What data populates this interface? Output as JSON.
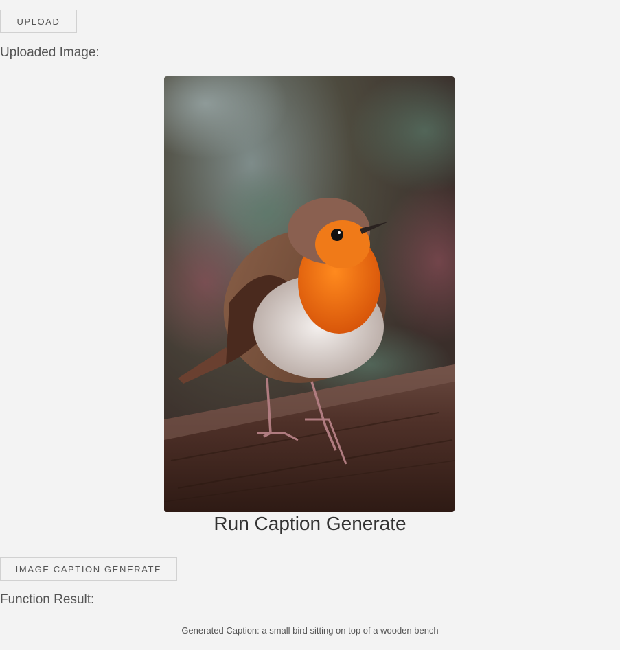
{
  "toolbar": {
    "upload_label": "UPLOAD"
  },
  "uploaded": {
    "label": "Uploaded Image:",
    "image_icon": "robin-photo"
  },
  "run": {
    "title": "Run Caption Generate",
    "button_label": "IMAGE CAPTION GENERATE"
  },
  "result": {
    "label": "Function Result:",
    "caption": "Generated Caption: a small bird sitting on top of a wooden bench"
  },
  "colors": {
    "background": "#f3f3f3",
    "text": "#555555",
    "button_border": "#d1d1d1"
  }
}
